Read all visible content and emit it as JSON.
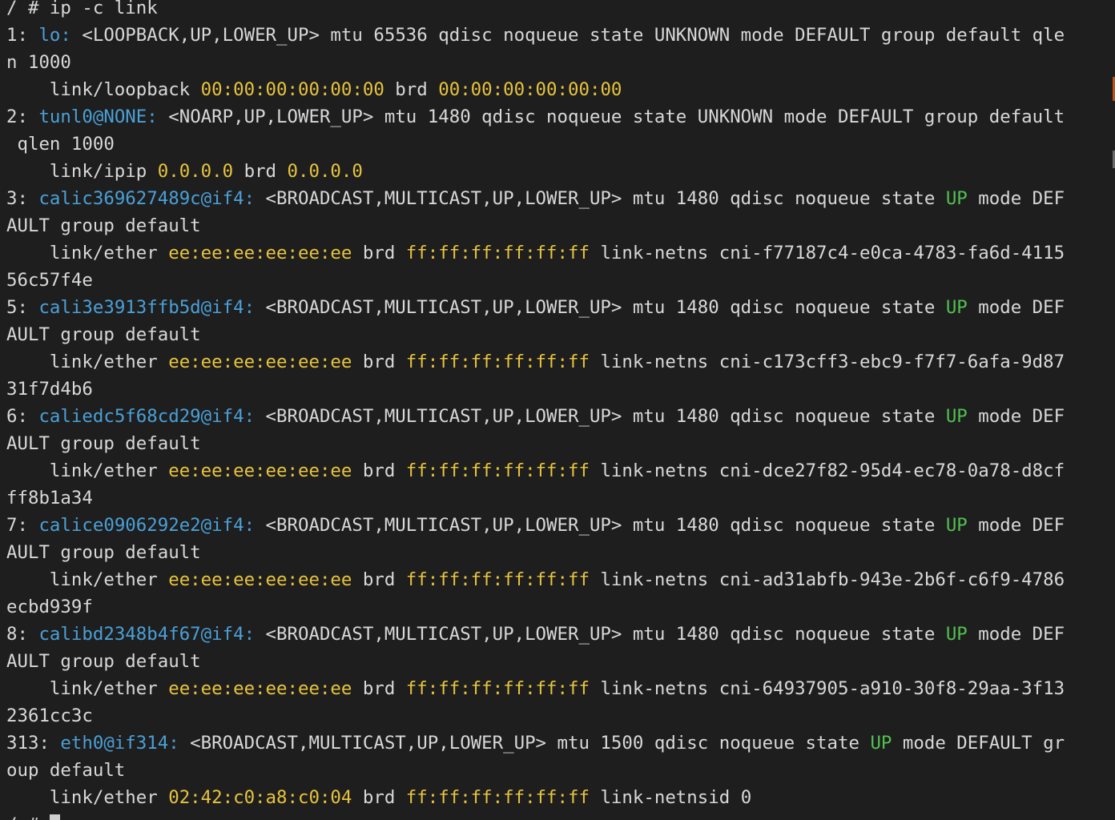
{
  "colors": {
    "background": "#1e1e1e",
    "text": "#d8d8d8",
    "interface": "#4aa0d8",
    "address": "#e8c43c",
    "state_up": "#52c150"
  },
  "lines": [
    [
      {
        "t": "plain",
        "v": "/ # ip -c link"
      }
    ],
    [
      {
        "t": "plain",
        "v": "1: "
      },
      {
        "t": "iface",
        "v": "lo:"
      },
      {
        "t": "plain",
        "v": " <LOOPBACK,UP,LOWER_UP> mtu 65536 qdisc noqueue state UNKNOWN mode DEFAULT group default qle"
      }
    ],
    [
      {
        "t": "plain",
        "v": "n 1000"
      }
    ],
    [
      {
        "t": "plain",
        "v": "    link/loopback "
      },
      {
        "t": "addr",
        "v": "00:00:00:00:00:00"
      },
      {
        "t": "plain",
        "v": " brd "
      },
      {
        "t": "addr",
        "v": "00:00:00:00:00:00"
      }
    ],
    [
      {
        "t": "plain",
        "v": "2: "
      },
      {
        "t": "iface",
        "v": "tunl0@NONE:"
      },
      {
        "t": "plain",
        "v": " <NOARP,UP,LOWER_UP> mtu 1480 qdisc noqueue state UNKNOWN mode DEFAULT group default"
      }
    ],
    [
      {
        "t": "plain",
        "v": " qlen 1000"
      }
    ],
    [
      {
        "t": "plain",
        "v": "    link/ipip "
      },
      {
        "t": "addr",
        "v": "0.0.0.0"
      },
      {
        "t": "plain",
        "v": " brd "
      },
      {
        "t": "addr",
        "v": "0.0.0.0"
      }
    ],
    [
      {
        "t": "plain",
        "v": "3: "
      },
      {
        "t": "iface",
        "v": "calic369627489c@if4:"
      },
      {
        "t": "plain",
        "v": " <BROADCAST,MULTICAST,UP,LOWER_UP> mtu 1480 qdisc noqueue state "
      },
      {
        "t": "state",
        "v": "UP"
      },
      {
        "t": "plain",
        "v": " mode DEF"
      }
    ],
    [
      {
        "t": "plain",
        "v": "AULT group default"
      }
    ],
    [
      {
        "t": "plain",
        "v": "    link/ether "
      },
      {
        "t": "addr",
        "v": "ee:ee:ee:ee:ee:ee"
      },
      {
        "t": "plain",
        "v": " brd "
      },
      {
        "t": "addr",
        "v": "ff:ff:ff:ff:ff:ff"
      },
      {
        "t": "plain",
        "v": " link-netns cni-f77187c4-e0ca-4783-fa6d-4115"
      }
    ],
    [
      {
        "t": "plain",
        "v": "56c57f4e"
      }
    ],
    [
      {
        "t": "plain",
        "v": "5: "
      },
      {
        "t": "iface",
        "v": "cali3e3913ffb5d@if4:"
      },
      {
        "t": "plain",
        "v": " <BROADCAST,MULTICAST,UP,LOWER_UP> mtu 1480 qdisc noqueue state "
      },
      {
        "t": "state",
        "v": "UP"
      },
      {
        "t": "plain",
        "v": " mode DEF"
      }
    ],
    [
      {
        "t": "plain",
        "v": "AULT group default"
      }
    ],
    [
      {
        "t": "plain",
        "v": "    link/ether "
      },
      {
        "t": "addr",
        "v": "ee:ee:ee:ee:ee:ee"
      },
      {
        "t": "plain",
        "v": " brd "
      },
      {
        "t": "addr",
        "v": "ff:ff:ff:ff:ff:ff"
      },
      {
        "t": "plain",
        "v": " link-netns cni-c173cff3-ebc9-f7f7-6afa-9d87"
      }
    ],
    [
      {
        "t": "plain",
        "v": "31f7d4b6"
      }
    ],
    [
      {
        "t": "plain",
        "v": "6: "
      },
      {
        "t": "iface",
        "v": "caliedc5f68cd29@if4:"
      },
      {
        "t": "plain",
        "v": " <BROADCAST,MULTICAST,UP,LOWER_UP> mtu 1480 qdisc noqueue state "
      },
      {
        "t": "state",
        "v": "UP"
      },
      {
        "t": "plain",
        "v": " mode DEF"
      }
    ],
    [
      {
        "t": "plain",
        "v": "AULT group default"
      }
    ],
    [
      {
        "t": "plain",
        "v": "    link/ether "
      },
      {
        "t": "addr",
        "v": "ee:ee:ee:ee:ee:ee"
      },
      {
        "t": "plain",
        "v": " brd "
      },
      {
        "t": "addr",
        "v": "ff:ff:ff:ff:ff:ff"
      },
      {
        "t": "plain",
        "v": " link-netns cni-dce27f82-95d4-ec78-0a78-d8cf"
      }
    ],
    [
      {
        "t": "plain",
        "v": "ff8b1a34"
      }
    ],
    [
      {
        "t": "plain",
        "v": "7: "
      },
      {
        "t": "iface",
        "v": "calice0906292e2@if4:"
      },
      {
        "t": "plain",
        "v": " <BROADCAST,MULTICAST,UP,LOWER_UP> mtu 1480 qdisc noqueue state "
      },
      {
        "t": "state",
        "v": "UP"
      },
      {
        "t": "plain",
        "v": " mode DEF"
      }
    ],
    [
      {
        "t": "plain",
        "v": "AULT group default"
      }
    ],
    [
      {
        "t": "plain",
        "v": "    link/ether "
      },
      {
        "t": "addr",
        "v": "ee:ee:ee:ee:ee:ee"
      },
      {
        "t": "plain",
        "v": " brd "
      },
      {
        "t": "addr",
        "v": "ff:ff:ff:ff:ff:ff"
      },
      {
        "t": "plain",
        "v": " link-netns cni-ad31abfb-943e-2b6f-c6f9-4786"
      }
    ],
    [
      {
        "t": "plain",
        "v": "ecbd939f"
      }
    ],
    [
      {
        "t": "plain",
        "v": "8: "
      },
      {
        "t": "iface",
        "v": "calibd2348b4f67@if4:"
      },
      {
        "t": "plain",
        "v": " <BROADCAST,MULTICAST,UP,LOWER_UP> mtu 1480 qdisc noqueue state "
      },
      {
        "t": "state",
        "v": "UP"
      },
      {
        "t": "plain",
        "v": " mode DEF"
      }
    ],
    [
      {
        "t": "plain",
        "v": "AULT group default"
      }
    ],
    [
      {
        "t": "plain",
        "v": "    link/ether "
      },
      {
        "t": "addr",
        "v": "ee:ee:ee:ee:ee:ee"
      },
      {
        "t": "plain",
        "v": " brd "
      },
      {
        "t": "addr",
        "v": "ff:ff:ff:ff:ff:ff"
      },
      {
        "t": "plain",
        "v": " link-netns cni-64937905-a910-30f8-29aa-3f13"
      }
    ],
    [
      {
        "t": "plain",
        "v": "2361cc3c"
      }
    ],
    [
      {
        "t": "plain",
        "v": "313: "
      },
      {
        "t": "iface",
        "v": "eth0@if314:"
      },
      {
        "t": "plain",
        "v": " <BROADCAST,MULTICAST,UP,LOWER_UP> mtu 1500 qdisc noqueue state "
      },
      {
        "t": "state",
        "v": "UP"
      },
      {
        "t": "plain",
        "v": " mode DEFAULT gr"
      }
    ],
    [
      {
        "t": "plain",
        "v": "oup default"
      }
    ],
    [
      {
        "t": "plain",
        "v": "    link/ether "
      },
      {
        "t": "addr",
        "v": "02:42:c0:a8:c0:04"
      },
      {
        "t": "plain",
        "v": " brd "
      },
      {
        "t": "addr",
        "v": "ff:ff:ff:ff:ff:ff"
      },
      {
        "t": "plain",
        "v": " link-netnsid 0"
      }
    ]
  ],
  "prompt": "/ # "
}
